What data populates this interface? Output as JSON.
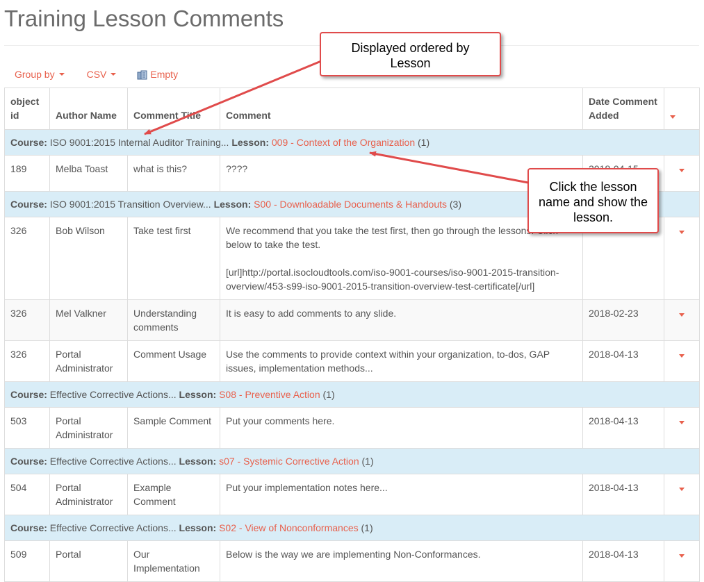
{
  "page": {
    "title": "Training Lesson Comments"
  },
  "toolbar": {
    "group_by": "Group by",
    "csv": "CSV",
    "empty": "Empty"
  },
  "table": {
    "headers": [
      "object id",
      "Author Name",
      "Comment Title",
      "Comment",
      "Date Comment Added"
    ],
    "group_course_label": "Course:",
    "group_lesson_label": "Lesson:",
    "groups": [
      {
        "course": "ISO 9001:2015 Internal Auditor Training...",
        "lesson": "009 - Context of the Organization",
        "count": "(1)",
        "rows": [
          {
            "id": "189",
            "author": "Melba Toast",
            "title": "what is this?",
            "comment": "????",
            "date": "2018-04-15"
          }
        ]
      },
      {
        "course": "ISO 9001:2015 Transition Overview...",
        "lesson": "S00 - Downloadable Documents & Handouts",
        "count": "(3)",
        "rows": [
          {
            "id": "326",
            "author": "Bob Wilson",
            "title": "Take test first",
            "comment": "We recommend that you take the test first, then go through the lessons. Click below to take the test.",
            "comment_url": "[url]http://portal.isocloudtools.com/iso-9001-courses/iso-9001-2015-transition-overview/453-s99-iso-9001-2015-transition-overview-test-certificate[/url]",
            "date": ""
          },
          {
            "id": "326",
            "author": "Mel Valkner",
            "title": "Understanding comments",
            "comment": "It is easy to add comments to any slide.",
            "date": "2018-02-23"
          },
          {
            "id": "326",
            "author": "Portal Administrator",
            "title": "Comment Usage",
            "comment": "Use the comments to provide context within your organization, to-dos, GAP issues, implementation methods...",
            "date": "2018-04-13"
          }
        ]
      },
      {
        "course": "Effective Corrective Actions...",
        "lesson": "S08 - Preventive Action",
        "count": "(1)",
        "rows": [
          {
            "id": "503",
            "author": "Portal Administrator",
            "title": "Sample Comment",
            "comment": "Put your comments here.",
            "date": "2018-04-13"
          }
        ]
      },
      {
        "course": "Effective Corrective Actions...",
        "lesson": "s07 - Systemic Corrective Action",
        "count": "(1)",
        "rows": [
          {
            "id": "504",
            "author": "Portal Administrator",
            "title": "Example Comment",
            "comment": "Put your implementation notes here...",
            "date": "2018-04-13"
          }
        ]
      },
      {
        "course": "Effective Corrective Actions...",
        "lesson": "S02 - View of Nonconformances",
        "count": "(1)",
        "rows": [
          {
            "id": "509",
            "author": "Portal",
            "title": "Our Implementation",
            "comment": "Below is the way we are implementing Non-Conformances.",
            "date": "2018-04-13"
          }
        ]
      }
    ]
  },
  "callouts": {
    "ordered": [
      "Displayed ordered by",
      "Lesson"
    ],
    "click": [
      "Click the lesson",
      "name and show the",
      "lesson."
    ]
  },
  "colors": {
    "accent": "#e8604c",
    "group_bg": "#d9edf7",
    "callout_border": "#e04b4b"
  }
}
